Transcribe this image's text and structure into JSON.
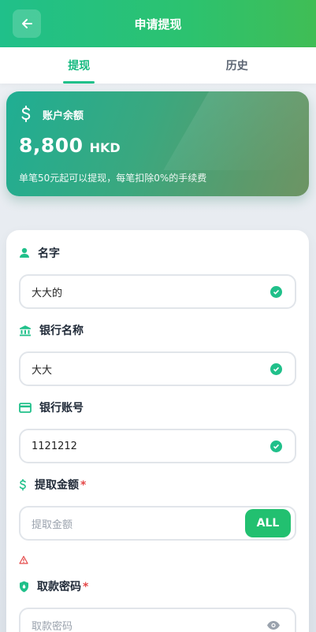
{
  "header": {
    "title": "申请提现",
    "back_icon": "arrow-left-icon"
  },
  "tabs": [
    {
      "label": "提现",
      "active": true
    },
    {
      "label": "历史",
      "active": false
    }
  ],
  "balance": {
    "label": "账户余额",
    "amount": "8,800",
    "currency": "HKD",
    "note": "单笔50元起可以提现，每笔扣除0%的手续费"
  },
  "form": {
    "name": {
      "label": "名字",
      "value": "大大的",
      "icon": "user-icon"
    },
    "bank_name": {
      "label": "银行名称",
      "value": "大大",
      "icon": "bank-icon"
    },
    "bank_account": {
      "label": "银行账号",
      "value": "1121212",
      "icon": "card-icon"
    },
    "amount": {
      "label": "提取金额",
      "required_mark": "*",
      "placeholder": "提取金额",
      "all_label": "ALL",
      "icon": "dollar-icon"
    },
    "password": {
      "label": "取款密码",
      "required_mark": "*",
      "placeholder": "取款密码",
      "icon": "shield-icon"
    }
  },
  "colors": {
    "primary": "#20c08a",
    "error": "#e44848"
  }
}
